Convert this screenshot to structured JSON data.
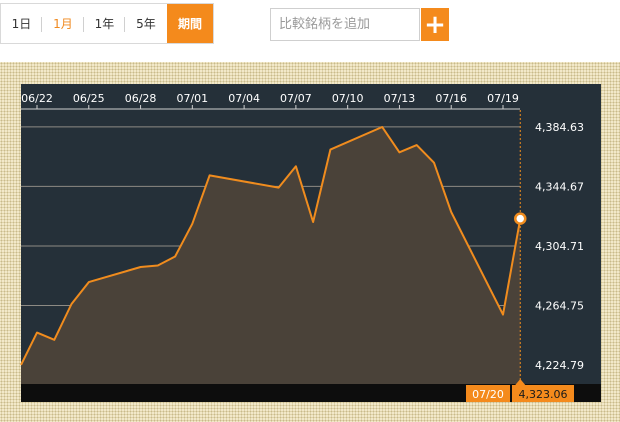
{
  "period_tabs": {
    "tab_1d": "1日",
    "tab_1m": "1月",
    "tab_1y": "1年",
    "tab_5y": "5年",
    "tab_custom": "期間"
  },
  "compare": {
    "placeholder": "比較銘柄を追加",
    "add_label": "+"
  },
  "colors": {
    "accent": "#f48a1c",
    "plot_bg": "#253039",
    "line": "#f08c1e",
    "area": "#4a4239",
    "grid": "#8d8a84",
    "frame_bg": "#f3eacb"
  },
  "chart_data": {
    "type": "area",
    "x_tick_labels": [
      "06/22",
      "06/25",
      "06/28",
      "07/01",
      "07/04",
      "07/07",
      "07/10",
      "07/13",
      "07/16",
      "07/19"
    ],
    "y_tick_labels": [
      "4,384.63",
      "4,344.67",
      "4,304.71",
      "4,264.75",
      "4,224.79"
    ],
    "ylim": [
      4212,
      4396
    ],
    "grid": true,
    "x": [
      "06/21",
      "06/22",
      "06/23",
      "06/24",
      "06/25",
      "06/28",
      "06/29",
      "06/30",
      "07/01",
      "07/02",
      "07/06",
      "07/07",
      "07/08",
      "07/09",
      "07/12",
      "07/13",
      "07/14",
      "07/15",
      "07/16",
      "07/19",
      "07/20"
    ],
    "values": [
      4224.8,
      4246.5,
      4241.7,
      4265.7,
      4280.4,
      4290.6,
      4291.6,
      4297.6,
      4319.6,
      4352.1,
      4343.9,
      4358.2,
      4320.8,
      4369.4,
      4384.6,
      4367.6,
      4372.4,
      4360.6,
      4327.5,
      4258.6,
      4323.06
    ],
    "last_date": "07/20",
    "last_value": "4,323.06"
  }
}
